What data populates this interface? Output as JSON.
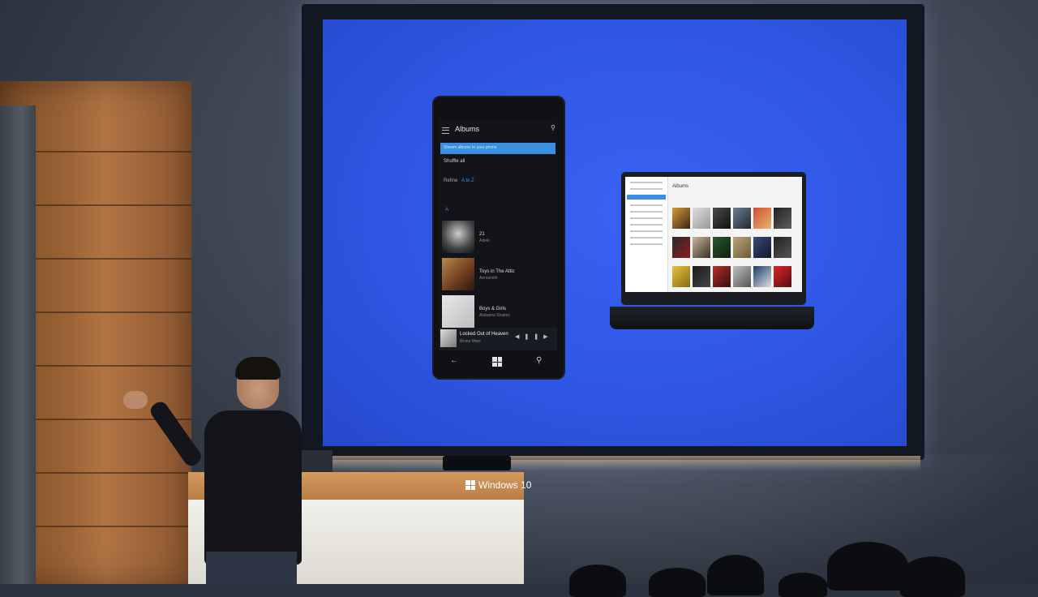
{
  "phone": {
    "title": "Albums",
    "highlight_text": "Stream albums to your phone",
    "shuffle_label": "Shuffle all",
    "refine_label": "Refine",
    "refine_value": "A to Z",
    "section_letter": "A",
    "albums": [
      {
        "name": "21",
        "sub": "Adele"
      },
      {
        "name": "Toys in The Attic",
        "sub": "Aerosmith"
      },
      {
        "name": "Boys & Girls",
        "sub": "Alabama Shakes"
      }
    ],
    "now_playing": {
      "title": "Locked Out of Heaven",
      "sub": "Bruno Mars"
    }
  },
  "laptop": {
    "title": "Albums"
  },
  "podium": {
    "brand": "Windows 10"
  },
  "colors": {
    "screen_blue": "#2f56e4",
    "accent": "#3a8fe0",
    "wood": "#9b6336"
  }
}
